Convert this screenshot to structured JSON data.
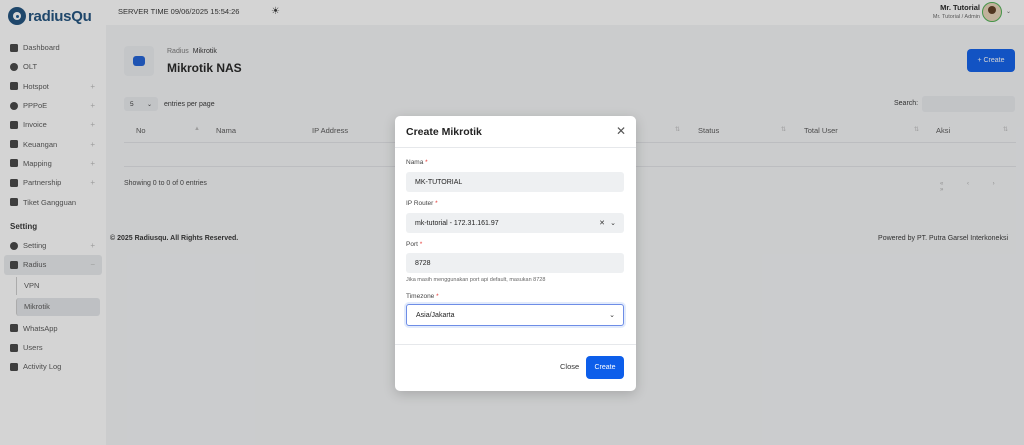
{
  "brand": {
    "logo_text": "radiusQu"
  },
  "topbar": {
    "server_time": "SERVER TIME 09/06/2025 15:54:26",
    "user_name": "Mr. Tutorial",
    "user_role": "Mr. Tutorial / Admin"
  },
  "sidebar": {
    "items": [
      {
        "label": "Dashboard",
        "expandable": false
      },
      {
        "label": "OLT",
        "expandable": false
      },
      {
        "label": "Hotspot",
        "expandable": true
      },
      {
        "label": "PPPoE",
        "expandable": true
      },
      {
        "label": "Invoice",
        "expandable": true
      },
      {
        "label": "Keuangan",
        "expandable": true
      },
      {
        "label": "Mapping",
        "expandable": true
      },
      {
        "label": "Partnership",
        "expandable": true
      },
      {
        "label": "Tiket Gangguan",
        "expandable": false
      }
    ],
    "section_title": "Setting",
    "setting_items": {
      "setting": "Setting",
      "radius": "Radius",
      "sub_vpn": "VPN",
      "sub_mikrotik": "Mikrotik",
      "whatsapp": "WhatsApp",
      "users": "Users",
      "activity_log": "Activity Log"
    }
  },
  "page": {
    "breadcrumb_root": "Radius",
    "breadcrumb_current": "Mikrotik",
    "title": "Mikrotik NAS",
    "create_button": "+ Create"
  },
  "table": {
    "entries_value": "5",
    "entries_label": "entries per page",
    "search_label": "Search:",
    "columns": [
      "No",
      "Nama",
      "IP Address",
      "Status",
      "Total User",
      "Aksi"
    ],
    "showing": "Showing 0 to 0 of 0 entries",
    "pager": "« ‹ › »"
  },
  "footer": {
    "left": "© 2025 Radiusqu. All Rights Reserved.",
    "right": "Powered by PT. Putra Garsel Interkoneksi"
  },
  "modal": {
    "title": "Create Mikrotik",
    "nama_label": "Nama",
    "nama_value": "MK-TUTORIAL",
    "ip_label": "IP Router",
    "ip_value": "mk-tutorial - 172.31.161.97",
    "port_label": "Port",
    "port_value": "8728",
    "port_help": "Jika masih menggunakan port api default, masukan 8728",
    "timezone_label": "Timezone",
    "timezone_value": "Asia/Jakarta",
    "close_button": "Close",
    "create_button": "Create"
  },
  "colors": {
    "primary": "#0d5eea",
    "brand": "#1d4f7c",
    "required": "#e53935"
  }
}
